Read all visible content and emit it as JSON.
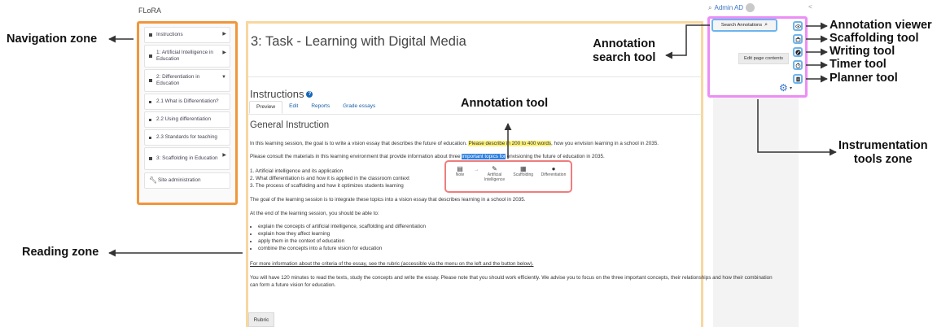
{
  "header": {
    "brand": "FLoRA",
    "user_name": "Admin AD"
  },
  "zone_labels": {
    "navigation": "Navigation zone",
    "reading": "Reading zone",
    "annotation_search": "Annotation\nsearch tool",
    "annotation_tool": "Annotation tool",
    "instrumentation": "Instrumentation\ntools zone",
    "annotation_viewer": "Annotation viewer",
    "scaffolding": "Scaffolding tool",
    "writing": "Writing tool",
    "timer": "Timer tool",
    "planner": "Planner tool"
  },
  "nav": {
    "items": [
      {
        "label": "Instructions",
        "caret": "▶"
      },
      {
        "label": "1: Artificial Intelligence in Education",
        "caret": "▶"
      },
      {
        "label": "2: Differentiation in Education",
        "caret": "▼"
      },
      {
        "label": "2.1 What is Differentiation?",
        "caret": ""
      },
      {
        "label": "2.2 Using differentiation",
        "caret": ""
      },
      {
        "label": "2.3 Standards for teaching",
        "caret": ""
      },
      {
        "label": "3: Scaffolding in Education",
        "caret": "▶"
      }
    ],
    "admin_label": "Site administration"
  },
  "page": {
    "title": "3: Task - Learning with Digital Media",
    "section_title": "Instructions",
    "help_icon_glyph": "?",
    "tabs": [
      "Preview",
      "Edit",
      "Reports",
      "Grade essays"
    ],
    "general_title": "General Instruction",
    "p1_a": "In this learning session, the goal is to write a vision essay that describes the future of education. ",
    "p1_hl": "Please describe in 200 to 400 words",
    "p1_b": ", how you envision learning in a school in 2035.",
    "p2_a": "Please consult the materials in this learning environment that provide information about three ",
    "p2_hl": "important topics for",
    "p2_b": " envisioning the future of education in 2035.",
    "list1": [
      "1. Artificial intelligence and its application",
      "2. What differentiation is and how it is applied in the classroom context",
      "3. The process of scaffolding and how it optimizes students learning"
    ],
    "p3": "The goal of the learning session is to integrate these topics into a vision essay that describes learning in a school in 2035.",
    "p4": "At the end of the learning session, you should be able to:",
    "bullets": [
      "explain the concepts of artificial intelligence, scaffolding and differentiation",
      "explain how they affect learning",
      "apply them in the context of education",
      "combine the concepts into a future vision for education"
    ],
    "p5": "For more information about the criteria of the essay, see the rubric (accessible via the menu on the left and the button below).",
    "p6_l1": "You will have 120 minutes to read the texts, study the concepts and write the essay. Please note that you should work efficiently. We advise you to focus on the three important concepts, their relationships and how their combination",
    "p6_l2": "can form a future vision for education.",
    "rubric_button": "Rubric"
  },
  "annotation_popup": {
    "items": [
      {
        "label": "Note",
        "icon": "note-icon"
      },
      {
        "label": "Artificial Intelligence",
        "icon": "pen-icon"
      },
      {
        "label": "Scaffolding",
        "icon": "scaffolding-icon"
      },
      {
        "label": "Differentiation",
        "icon": "info-icon"
      }
    ]
  },
  "instrumentation": {
    "search_button": "Search Annotations",
    "edit_button": "Edit page contents"
  },
  "colors": {
    "navigation_zone": "#f0963c",
    "reading_zone": "#f8d79f",
    "annotation_tool": "#ef7d7d",
    "instrumentation_zone": "#ec8ef5",
    "tool_buttons": "#6bb5ee",
    "highlight_yellow": "#fff27a",
    "highlight_blue": "#2a7ee0"
  }
}
